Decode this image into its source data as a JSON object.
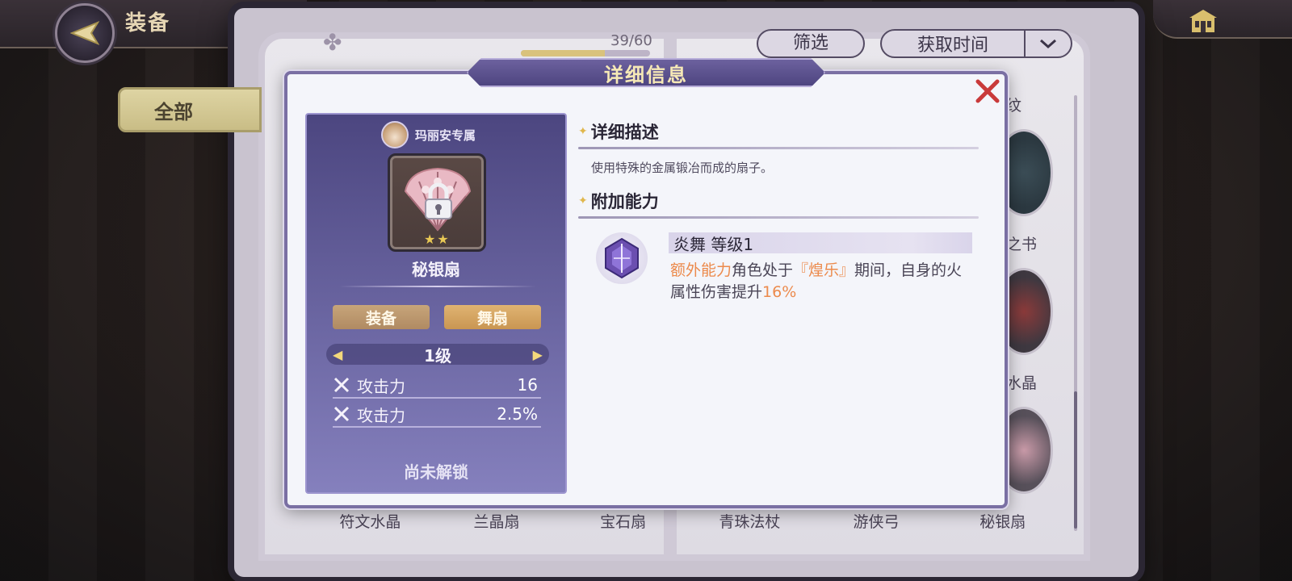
{
  "header": {
    "title": "装备"
  },
  "tabs": {
    "all_label": "全部"
  },
  "book": {
    "count": "39/60",
    "count_fraction": 0.65,
    "filter_label": "筛选",
    "sort_label": "获取时间"
  },
  "side_labels": {
    "label_1": "纹",
    "label_2": "之书",
    "label_3": "水晶"
  },
  "item_names": [
    "符文水晶",
    "兰晶扇",
    "宝石扇",
    "青珠法杖",
    "游侠弓",
    "秘银扇"
  ],
  "dialog": {
    "title": "详细信息",
    "card": {
      "owner": "玛丽安专属",
      "item_name": "秘银扇",
      "stars": 2,
      "tag_equip": "装备",
      "tag_type": "舞扇",
      "level": "1级",
      "stats": [
        {
          "label": "攻击力",
          "value": "16"
        },
        {
          "label": "攻击力",
          "value": "2.5%"
        }
      ],
      "unlock_label": "尚未解锁"
    },
    "desc_section": {
      "heading": "详细描述",
      "text": "使用特殊的金属锻冶而成的扇子。"
    },
    "ability_section": {
      "heading": "附加能力",
      "skill_title": "炎舞  等级1",
      "skill_prefix": "额外能力",
      "skill_mid1": "角色处于",
      "skill_state": "『煌乐』",
      "skill_mid2": "期间，自身的火属性伤害提升",
      "skill_value": "16%"
    }
  },
  "colors": {
    "accent_gold": "#e0b74d",
    "highlight_orange": "#ec8a4c",
    "card_purple": "#4c4680",
    "close_red": "#c93a3a"
  },
  "icons": {
    "back": "back-arrow-icon",
    "home": "home-icon",
    "close": "close-icon",
    "lock": "lock-icon",
    "stat": "crossed-swords-icon",
    "skill": "skill-crystal-icon"
  }
}
